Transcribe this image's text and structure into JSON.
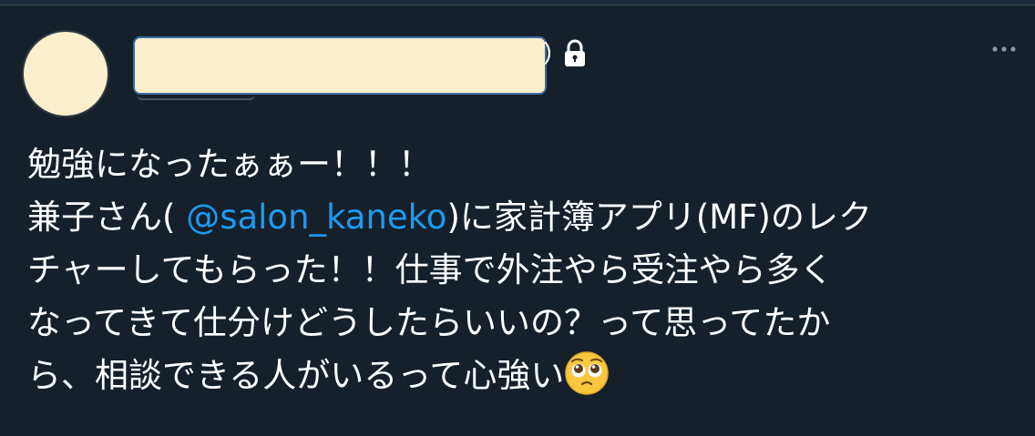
{
  "header": {
    "name_suffix": ")"
  },
  "icons": {
    "lock": "lock-icon",
    "more": "more-icon",
    "emoji": "pleading-face-emoji"
  },
  "colors": {
    "background": "#15202b",
    "text": "#ffffff",
    "mention": "#1d9bf0",
    "redaction": "#fcefcd"
  },
  "tweet": {
    "line1": "勉強になったぁぁー！！！",
    "line2_before": "兼子さん( ",
    "mention": "@salon_kaneko",
    "line2_after": ")に家計簿アプリ(MF)のレク",
    "line3": "チャーしてもらった！！仕事で外注やら受注やら多く",
    "line4": "なってきて仕分けどうしたらいいの？って思ってたか",
    "line5": "ら、相談できる人がいるって心強い"
  }
}
